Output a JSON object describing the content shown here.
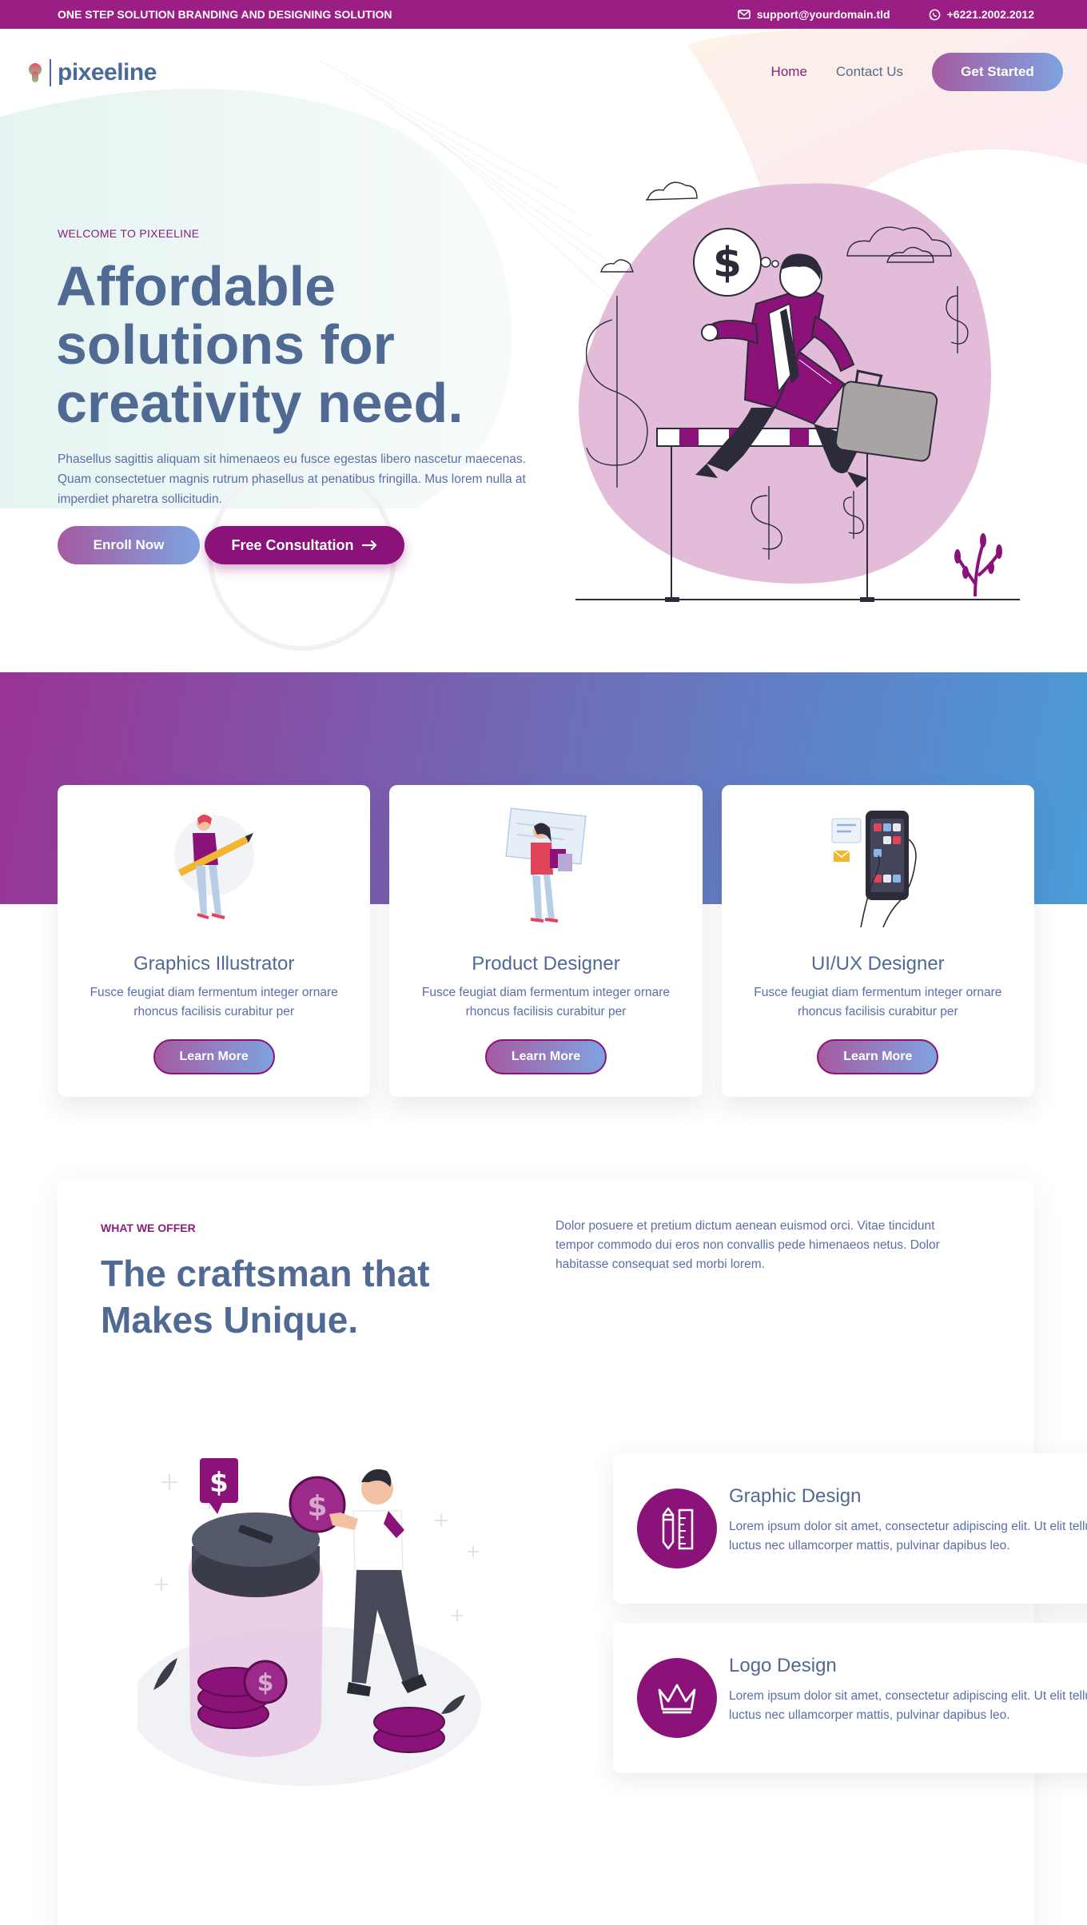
{
  "topbar": {
    "tagline": "ONE STEP SOLUTION BRANDING AND DESIGNING SOLUTION",
    "email": "support@yourdomain.tld",
    "phone": "+6221.2002.2012",
    "email_icon": "envelope-icon",
    "phone_icon": "whatsapp-icon"
  },
  "header": {
    "logo_text": "pixeeline",
    "nav": [
      {
        "label": "Home",
        "active": true
      },
      {
        "label": "Contact Us",
        "active": false
      }
    ],
    "cta_label": "Get Started"
  },
  "hero": {
    "eyebrow": "WELCOME TO PIXEELINE",
    "title": "Affordable solutions for creativity need.",
    "description": "Phasellus sagittis aliquam sit himenaeos eu fusce egestas libero nascetur maecenas. Quam consectetuer magnis rutrum phasellus at penatibus fringilla. Mus lorem nulla at imperdiet pharetra sollicitudin.",
    "primary_button": "Enroll Now",
    "secondary_button": "Free Consultation",
    "illustration": "businessman-hurdle-illustration"
  },
  "services": [
    {
      "title": "Graphics Illustrator",
      "description": "Fusce feugiat diam fermentum integer ornare rhoncus facilisis curabitur per",
      "button": "Learn More",
      "illustration": "woman-with-pencil-illustration"
    },
    {
      "title": "Product Designer",
      "description": "Fusce feugiat diam fermentum integer ornare rhoncus facilisis curabitur per",
      "button": "Learn More",
      "illustration": "woman-with-shopping-bags-illustration"
    },
    {
      "title": "UI/UX Designer",
      "description": "Fusce feugiat diam fermentum integer ornare rhoncus facilisis curabitur per",
      "button": "Learn More",
      "illustration": "hand-holding-phone-illustration"
    }
  ],
  "offer": {
    "eyebrow": "WHAT WE OFFER",
    "title": "The craftsman that Makes Unique.",
    "description": "Dolor posuere et pretium dictum aenean euismod orci. Vitae tincidunt tempor commodo dui eros non convallis pede himenaeos netus. Dolor habitasse consequat sed morbi lorem.",
    "illustration": "man-with-coin-jar-illustration",
    "features": [
      {
        "title": "Graphic Design",
        "description": "Lorem ipsum dolor sit amet, consectetur adipiscing elit. Ut elit tellus, luctus nec ullamcorper mattis, pulvinar dapibus leo.",
        "icon": "pencil-ruler-icon"
      },
      {
        "title": "Logo Design",
        "description": "Lorem ipsum dolor sit amet, consectetur adipiscing elit. Ut elit tellus, luctus nec ullamcorper mattis, pulvinar dapibus leo.",
        "icon": "crown-icon"
      }
    ]
  },
  "colors": {
    "brand_purple": "#9b1e84",
    "heading_blue": "#506a93",
    "gradient_start": "#9a3494",
    "gradient_end": "#4b9bd8"
  }
}
